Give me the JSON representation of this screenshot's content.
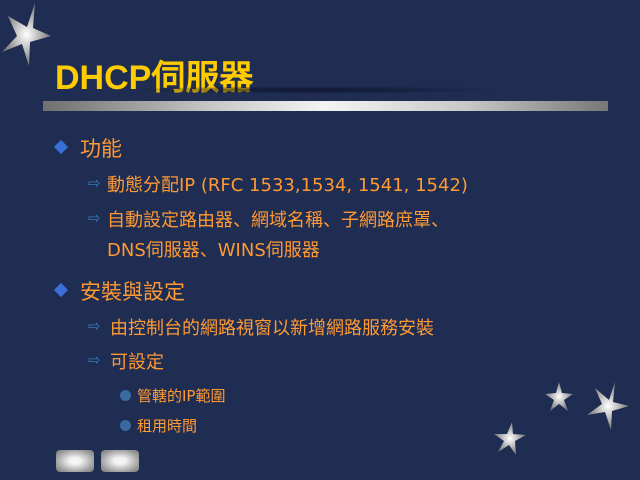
{
  "title": "DHCP伺服器",
  "sections": [
    {
      "label": "功能",
      "items": [
        {
          "label": "動態分配IP (RFC 1533,1534, 1541, 1542)"
        },
        {
          "label": "自動設定路由器、網域名稱、子網路庶罩、",
          "cont": "DNS伺服器、WINS伺服器"
        }
      ]
    },
    {
      "label": "安裝與設定",
      "items": [
        {
          "label": "由控制台的網路視窗以新增網路服務安裝"
        },
        {
          "label": "可設定",
          "subitems": [
            "管轄的IP範圍",
            "租用時間"
          ]
        }
      ]
    }
  ],
  "colors": {
    "background": "#1f2d52",
    "title": "#ffcc00",
    "text": "#ff9933",
    "bullet": "#3a6fd8"
  }
}
